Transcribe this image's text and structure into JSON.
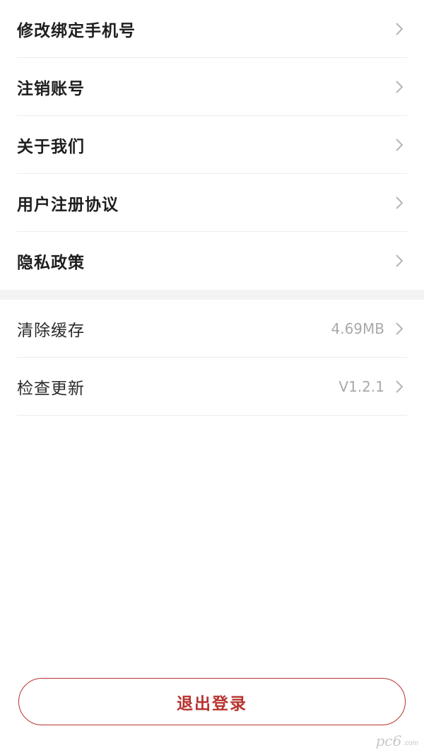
{
  "group_main": {
    "items": [
      {
        "label": "修改绑定手机号"
      },
      {
        "label": "注销账号"
      },
      {
        "label": "关于我们"
      },
      {
        "label": "用户注册协议"
      },
      {
        "label": "隐私政策"
      }
    ]
  },
  "group_system": {
    "items": [
      {
        "label": "清除缓存",
        "value": "4.69MB"
      },
      {
        "label": "检查更新",
        "value": "V1.2.1"
      }
    ]
  },
  "logout": {
    "label": "退出登录"
  },
  "watermark": {
    "main": "pc6",
    "sub": ".com"
  },
  "icons": {
    "row_arrow": "chevron-right-icon"
  },
  "colors": {
    "accent": "#b7332f",
    "value_text": "#a9a9a9",
    "divider": "#ececec",
    "section_gap": "#f3f3f3"
  }
}
